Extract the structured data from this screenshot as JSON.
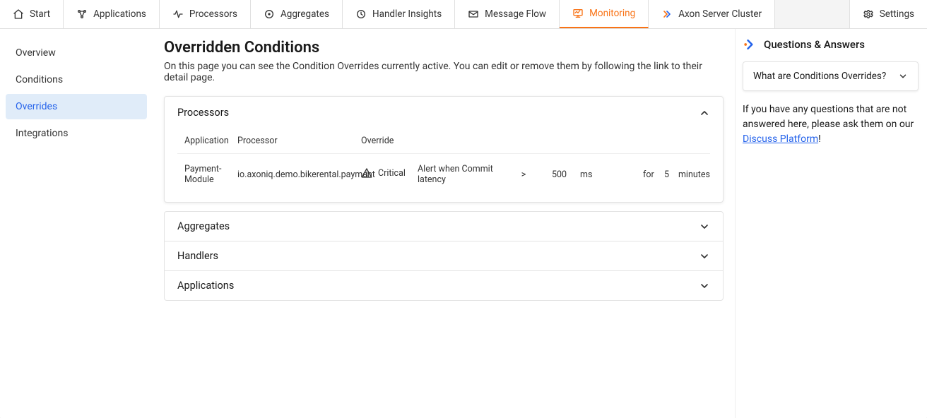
{
  "top_tabs": {
    "start": "Start",
    "applications": "Applications",
    "processors": "Processors",
    "aggregates": "Aggregates",
    "handler_insights": "Handler Insights",
    "message_flow": "Message Flow",
    "monitoring": "Monitoring",
    "axon_cluster": "Axon Server Cluster",
    "settings": "Settings"
  },
  "sidebar": {
    "items": [
      {
        "label": "Overview"
      },
      {
        "label": "Conditions"
      },
      {
        "label": "Overrides"
      },
      {
        "label": "Integrations"
      }
    ]
  },
  "page": {
    "title": "Overridden Conditions",
    "subtitle": "On this page you can see the Condition Overrides currently active. You can edit or remove them by following the link to their detail page."
  },
  "processors_panel": {
    "title": "Processors",
    "columns": {
      "application": "Application",
      "processor": "Processor",
      "override": "Override"
    },
    "rows": [
      {
        "application": "Payment-Module",
        "processor": "io.axoniq.demo.bikerental.payment",
        "severity": "Critical",
        "rule_text": "Alert when Commit latency",
        "operator": ">",
        "value": "500",
        "unit": "ms",
        "duration_prefix": "for",
        "duration_value": "5",
        "duration_unit": "minutes"
      }
    ]
  },
  "collapsed_panels": [
    {
      "title": "Aggregates"
    },
    {
      "title": "Handlers"
    },
    {
      "title": "Applications"
    }
  ],
  "qa": {
    "title": "Questions & Answers",
    "items": [
      {
        "label": "What are Conditions Overrides?"
      }
    ],
    "footer_pre": "If you have any questions that are not answered here, please ask them on our ",
    "footer_link": "Discuss Platform",
    "footer_post": "!"
  }
}
